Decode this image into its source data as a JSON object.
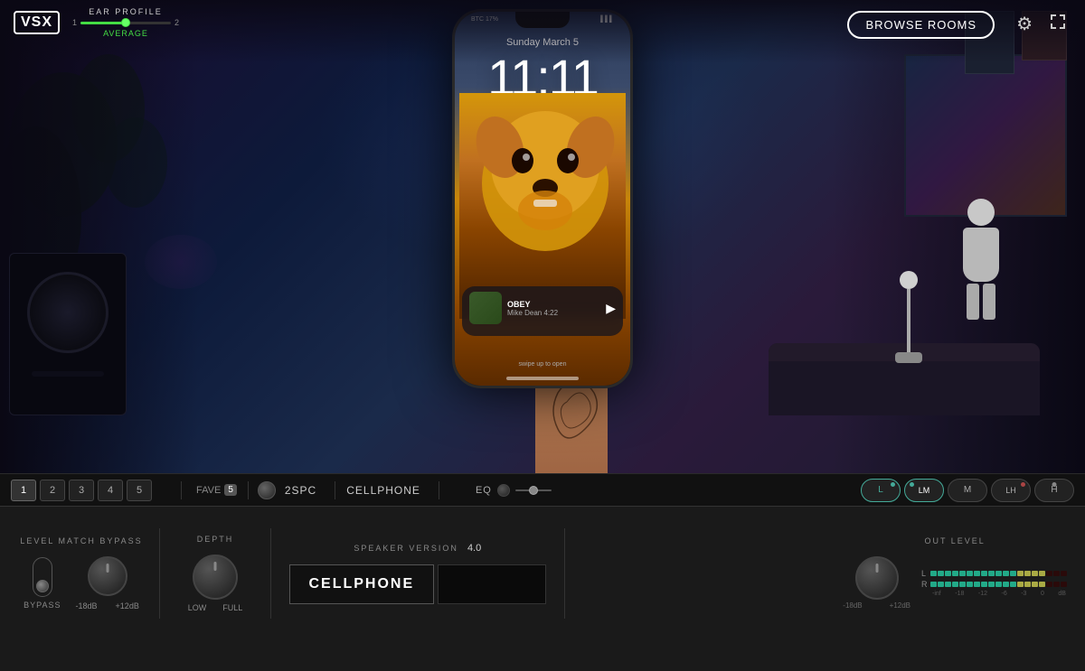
{
  "app": {
    "logo": "VSX",
    "ear_profile_label": "EAR PROFILE",
    "ear_slider_min": "1",
    "ear_slider_max": "2",
    "ear_avg_label": "AVERAGE",
    "browse_rooms_label": "BROWSE ROOMS"
  },
  "tabbar": {
    "tabs": [
      {
        "num": "1",
        "active": true
      },
      {
        "num": "2",
        "active": false
      },
      {
        "num": "3",
        "active": false
      },
      {
        "num": "4",
        "active": false
      },
      {
        "num": "5",
        "active": false
      }
    ],
    "fave_label": "FAVE",
    "fave_num": "5",
    "knob_label": "2SPC",
    "speaker_label": "CELLPHONE",
    "eq_label": "EQ",
    "speaker_modes": [
      "L",
      "LM",
      "M",
      "LH",
      "H"
    ]
  },
  "controls": {
    "level_match_bypass_label": "LEVEL MATCH BYPASS",
    "depth_label": "DEPTH",
    "speaker_version_label": "SPEAKER VERSION",
    "speaker_version_val": "4.0",
    "out_level_label": "OUT LEVEL",
    "bypass_label": "BYPASS",
    "level_neg18": "-18dB",
    "level_pos12": "+12dB",
    "depth_low": "LOW",
    "depth_full": "FULL",
    "speaker_name": "CELLPHONE",
    "meter_labels": [
      "-inf",
      "-18",
      "-12",
      "-6",
      "-3",
      "0",
      "dB"
    ]
  },
  "phone": {
    "date": "Sunday March 5",
    "time": "11:11",
    "music_title": "OBEY",
    "music_artist": "Mike Dean  4:22",
    "battery": "BTC 17%"
  }
}
